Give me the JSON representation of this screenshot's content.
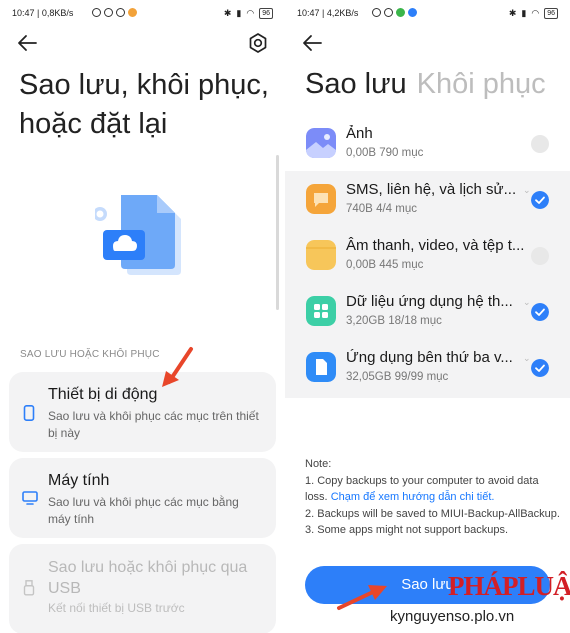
{
  "left": {
    "status": {
      "text": "10:47 | 0,8KB/s",
      "battery": "96"
    },
    "title": "Sao lưu, khôi phục, hoặc đặt lại",
    "section_header": "SAO LƯU HOẶC KHÔI PHỤC",
    "options": [
      {
        "title": "Thiết bị di động",
        "desc": "Sao lưu và khôi phục các mục trên thiết bị này",
        "icon": "phone-icon",
        "enabled": true
      },
      {
        "title": "Máy tính",
        "desc": "Sao lưu và khôi phục các mục bằng máy tính",
        "icon": "monitor-icon",
        "enabled": true
      },
      {
        "title": "Sao lưu hoặc khôi phục qua USB",
        "desc": "Kết nối thiết bị USB trước",
        "icon": "usb-icon",
        "enabled": false
      }
    ]
  },
  "right": {
    "status": {
      "text": "10:47 | 4,2KB/s",
      "battery": "96"
    },
    "tabs": [
      {
        "label": "Sao lưu",
        "active": true
      },
      {
        "label": "Khôi phục",
        "active": false
      }
    ],
    "items": [
      {
        "title": "Ảnh",
        "size": "0,00B",
        "count": "790 mục",
        "checked": false,
        "icon": "photos-icon",
        "color": "#7c8cf8"
      },
      {
        "title": "SMS, liên hệ, và lịch sử...",
        "size": "740B",
        "count": "4/4 mục",
        "checked": true,
        "icon": "message-icon",
        "color": "#f5a53a"
      },
      {
        "title": "Âm thanh, video, và tệp t...",
        "size": "0,00B",
        "count": "445 mục",
        "checked": false,
        "icon": "folder-icon",
        "color": "#f7c65a"
      },
      {
        "title": "Dữ liệu ứng dụng hệ th...",
        "size": "3,20GB",
        "count": "18/18 mục",
        "checked": true,
        "icon": "apps-icon",
        "color": "#3ccfa6"
      },
      {
        "title": "Ứng dụng bên thứ ba v...",
        "size": "32,05GB",
        "count": "99/99 mục",
        "checked": true,
        "icon": "file-icon",
        "color": "#2f8cf7"
      }
    ],
    "note": {
      "heading": "Note:",
      "line1": "1. Copy backups to your computer to avoid data loss. ",
      "link": "Chạm để xem hướng dẫn chi tiết.",
      "line2": "2. Backups will be saved to MIUI-Backup-AllBackup.",
      "line3": "3. Some apps might not support backups."
    },
    "button": "Sao lưu"
  },
  "watermark": {
    "logo": "PHÁPLUẬT",
    "site": "kynguyenso.plo.vn"
  },
  "colors": {
    "accent": "#2d7ff9",
    "annotation": "#e8462a",
    "card": "#f3f3f4"
  }
}
